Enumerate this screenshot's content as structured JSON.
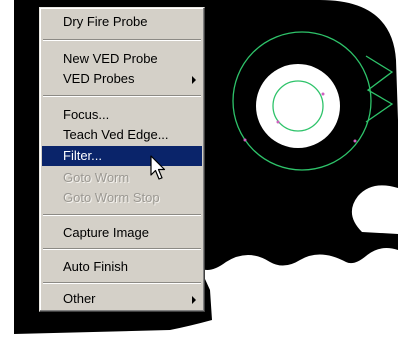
{
  "context_menu": {
    "items": [
      {
        "label": "Dry Fire Probe",
        "enabled": true
      },
      {
        "label": "New VED Probe",
        "enabled": true
      },
      {
        "label": "VED Probes",
        "enabled": true,
        "has_submenu": true
      },
      {
        "label": "Focus...",
        "enabled": true
      },
      {
        "label": "Teach Ved Edge...",
        "enabled": true
      },
      {
        "label": "Filter...",
        "enabled": true,
        "highlighted": true
      },
      {
        "label": "Goto Worm",
        "enabled": false
      },
      {
        "label": "Goto Worm Stop",
        "enabled": false
      },
      {
        "label": "Capture Image",
        "enabled": true
      },
      {
        "label": "Auto Finish",
        "enabled": true
      },
      {
        "label": "Other",
        "enabled": true,
        "has_submenu": true
      }
    ]
  },
  "colors": {
    "menu_background": "#d4d0c8",
    "highlight": "#0a246a",
    "highlight_text": "#ffffff",
    "disabled_text": "#9b9892",
    "part_fill": "#000000",
    "overlay_circle": "#2ec36a",
    "overlay_marker": "#d060c0"
  },
  "icons": {
    "pointer": "arrow-cursor-icon",
    "submenu": "chevron-right-icon"
  }
}
